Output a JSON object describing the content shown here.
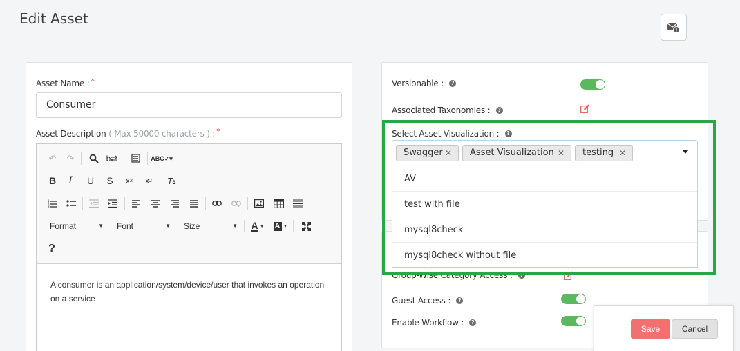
{
  "page": {
    "title": "Edit Asset"
  },
  "header": {
    "notification_icon": "mail-alert-icon"
  },
  "asset_name": {
    "label": "Asset Name :",
    "required": "*",
    "value": "Consumer"
  },
  "asset_description": {
    "label": "Asset Description",
    "hint": "( Max 50000 characters )",
    "suffix": ":",
    "required": "*",
    "text": "A consumer is an application/system/device/user that invokes an operation on a service"
  },
  "editor_toolbar": {
    "format_label": "Format",
    "font_label": "Font",
    "size_label": "Size",
    "help_label": "?"
  },
  "settings": {
    "versionable": {
      "label": "Versionable :",
      "enabled": true
    },
    "associated_taxonomies": {
      "label": "Associated Taxonomies :"
    },
    "select_visualization": {
      "label": "Select Asset Visualization :",
      "selected": [
        "Swagger",
        "Asset Visualization",
        "testing"
      ],
      "options": [
        "AV",
        "test with file",
        "mysql8check",
        "mysql8check without file"
      ]
    },
    "group_wise_category_access": {
      "label": "Group-Wise Category Access :"
    },
    "guest_access": {
      "label": "Guest Access :",
      "enabled": true
    },
    "enable_workflow": {
      "label": "Enable Workflow :",
      "enabled": true
    }
  },
  "actions": {
    "save_label": "Save",
    "cancel_label": "Cancel"
  },
  "colors": {
    "accent_green": "#5cb85c",
    "save_red": "#f17171",
    "highlight_green": "#27a745"
  }
}
